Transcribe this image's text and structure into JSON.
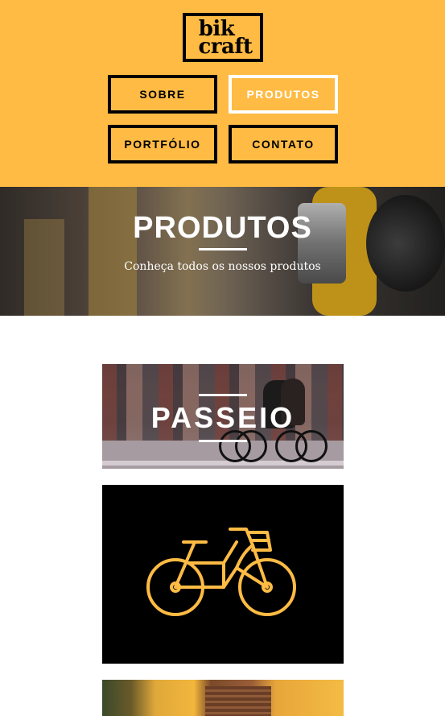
{
  "header": {
    "logo": {
      "line1": "bik",
      "line2": "craft"
    },
    "nav": [
      {
        "label": "SOBRE",
        "active": false
      },
      {
        "label": "PRODUTOS",
        "active": true
      },
      {
        "label": "PORTFÓLIO",
        "active": false
      },
      {
        "label": "CONTATO",
        "active": false
      }
    ]
  },
  "hero": {
    "title": "PRODUTOS",
    "subtitle": "Conheça todos os nossos produtos"
  },
  "products": [
    {
      "title": "PASSEIO"
    },
    {
      "icon": "bicycle-icon"
    }
  ],
  "colors": {
    "brand_yellow": "#FFBB44",
    "dark": "#000000",
    "light": "#FFFFFF"
  }
}
